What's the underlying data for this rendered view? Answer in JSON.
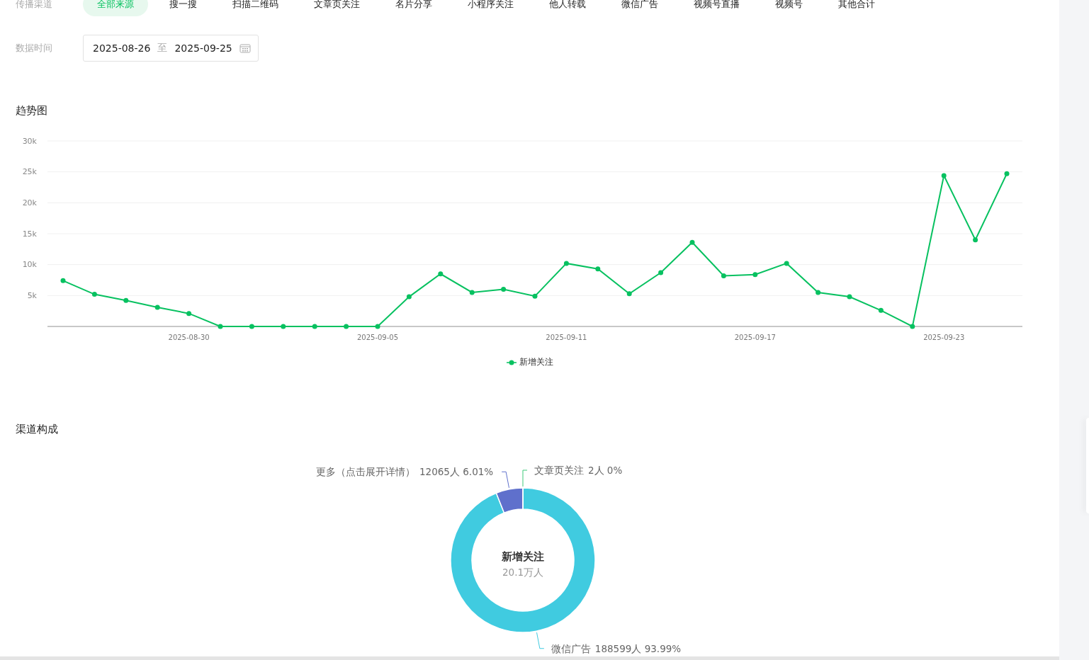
{
  "filters": {
    "channel_label": "传播渠道",
    "channels": [
      {
        "label": "全部来源",
        "selected": true
      },
      {
        "label": "搜一搜",
        "selected": false
      },
      {
        "label": "扫描二维码",
        "selected": false
      },
      {
        "label": "文章页关注",
        "selected": false
      },
      {
        "label": "名片分享",
        "selected": false
      },
      {
        "label": "小程序关注",
        "selected": false
      },
      {
        "label": "他人转载",
        "selected": false
      },
      {
        "label": "微信广告",
        "selected": false
      },
      {
        "label": "视频号直播",
        "selected": false
      },
      {
        "label": "视频号",
        "selected": false
      },
      {
        "label": "其他合计",
        "selected": false
      }
    ],
    "date_label": "数据时间",
    "date_range": {
      "start": "2025-08-26",
      "separator": "至",
      "end": "2025-09-25"
    }
  },
  "trend": {
    "title": "趋势图",
    "chart_data": {
      "type": "line",
      "categories": [
        null,
        null,
        null,
        null,
        "2025-08-30",
        null,
        null,
        null,
        null,
        null,
        "2025-09-05",
        null,
        null,
        null,
        null,
        null,
        "2025-09-11",
        null,
        null,
        null,
        null,
        null,
        "2025-09-17",
        null,
        null,
        null,
        null,
        null,
        "2025-09-23",
        null,
        null
      ],
      "grid": true,
      "series": [
        {
          "name": "新增关注",
          "color": "#07c160",
          "marker": "circle",
          "values": [
            7400,
            5200,
            4200,
            3100,
            2100,
            0,
            0,
            0,
            0,
            0,
            0,
            4800,
            8500,
            5500,
            6000,
            4900,
            10200,
            9300,
            5300,
            8700,
            13600,
            8200,
            8400,
            10200,
            5500,
            4800,
            2600,
            0,
            24400,
            14000,
            24700
          ]
        }
      ],
      "ylim": [
        0,
        30000
      ],
      "yticks": [
        {
          "value": 5000,
          "label": "5k"
        },
        {
          "value": 10000,
          "label": "10k"
        },
        {
          "value": 15000,
          "label": "15k"
        },
        {
          "value": 20000,
          "label": "20k"
        },
        {
          "value": 25000,
          "label": "25k"
        },
        {
          "value": 30000,
          "label": "30k"
        }
      ]
    }
  },
  "composition": {
    "title": "渠道构成",
    "center_title": "新增关注",
    "center_value": "20.1万人",
    "chart_data": {
      "type": "donut",
      "categories": [
        "微信广告",
        "更多（点击展开详情）",
        "文章页关注"
      ],
      "values": [
        188599,
        12065,
        2
      ],
      "colors": [
        "#40cbe0",
        "#5f70cc",
        "#3fc97a"
      ],
      "value_labels": [
        "188599人 93.99%",
        "12065人 6.01%",
        "2人 0%"
      ]
    }
  }
}
